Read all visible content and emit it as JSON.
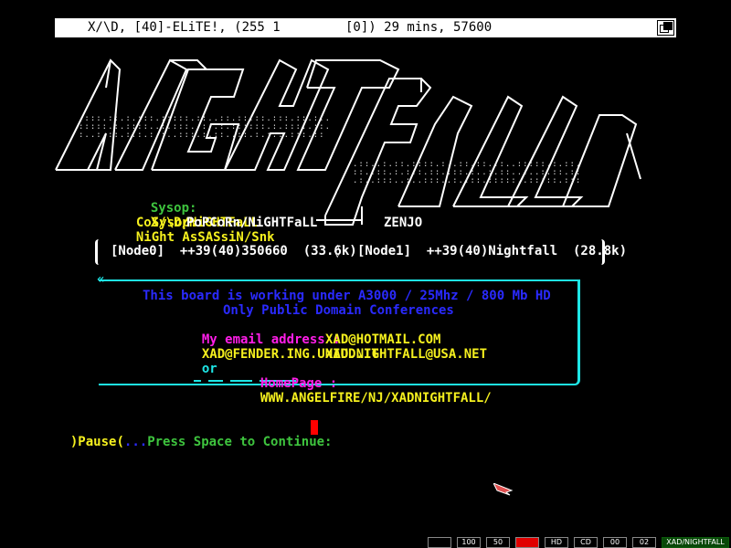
{
  "titlebar": {
    "left": "X/\\D, [40]-ELiTE!, (255 1",
    "right": "[0]) 29 mins, 57600",
    "depth_icon": "depth-gadget-icon"
  },
  "logo_name": "nightfall-ascii-logo",
  "sysop": {
    "label": "Sysop:",
    "value": "X/\\D/NiGHTFaLL"
  },
  "cosysop": {
    "label": "CoSysop:",
    "value": "NiGht AsSASsiN/Snk"
  },
  "popcorn": "PoPCoRn/NiGHTFaLL",
  "zenjo": "ZENJO",
  "nodes": {
    "node0": "[Node0]  ++39(40)350660  (33.6k)",
    "separator": "◊",
    "node1": "[Node1]  ++39(40)Nightfall  (28.8k)"
  },
  "info": {
    "line1": "This board is working under A3000 / 25Mhz / 800 Mb HD",
    "line2": "Only Public Domain Conferences",
    "email_label": "My email address :",
    "email1": "XAD@FENDER.ING.UNIUD.IT",
    "or": "or",
    "email2": "XAD@HOTMAIL.COM",
    "email3": "XAD.NIGHTFALL@USA.NET",
    "homepage_label": "HomePage :",
    "homepage": "WWW.ANGELFIRE/NJ/XADNIGHTFALL/"
  },
  "pause": {
    "open": ")",
    "label": "Pause",
    "close": "(",
    "dots": "...",
    "message": "Press Space to Continue:"
  },
  "statusbar": [
    "100",
    "50",
    "",
    "HD",
    "CD",
    "00",
    "02",
    "XAD/NIGHTFALL"
  ],
  "colors": {
    "green": "#3ec43e",
    "yellow": "#f5f01e",
    "blue": "#2a2aff",
    "magenta": "#ff1ee8",
    "cyan": "#1ee6e6",
    "cursor": "#ff0000"
  }
}
